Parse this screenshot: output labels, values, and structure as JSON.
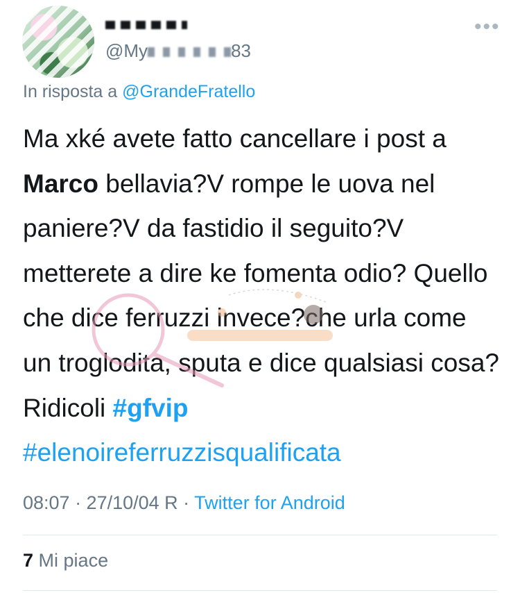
{
  "author": {
    "display_name_prefix": "",
    "display_name_suffix": "",
    "handle_prefix": "@My",
    "handle_suffix": "83",
    "avatar": "avatar-image"
  },
  "menu_icon": "more-horizontal-icon",
  "reply": {
    "prefix": "In risposta a",
    "mention": "@GrandeFratello"
  },
  "tweet": {
    "part1": "Ma xké avete fatto cancellare i post a ",
    "bold_name": "Marco",
    "part2": " bellavia?V rompe le uova nel paniere?V da fastidio il seguito?V metterete a dire ke fomenta odio? Quello che dice ferruzzi invece?che urla come un troglodita, sputa e dice qualsiasi cosa? Ridicoli ",
    "hashtag1": "#gfvip",
    "hashtag2": "#elenoireferruzzisqualificata"
  },
  "meta": {
    "time_date": "08:07 · 27/10/04 R ·",
    "source": "Twitter for Android"
  },
  "likes": {
    "count": "7",
    "label": "Mi piace"
  },
  "colors": {
    "link": "#1da1f2",
    "secondary": "#657786",
    "text": "#14171a",
    "divider": "#e1e8ed"
  }
}
